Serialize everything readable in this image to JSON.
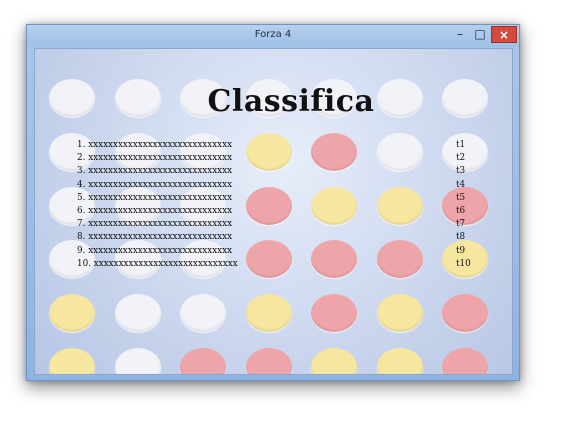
{
  "window": {
    "title": "Forza 4",
    "controls": {
      "minimize": "–",
      "maximize": "□",
      "close": "×"
    }
  },
  "leaderboard": {
    "heading": "Classifica",
    "rows": [
      {
        "name": "1. xxxxxxxxxxxxxxxxxxxxxxxxxxxxx",
        "time": "t1"
      },
      {
        "name": "2. xxxxxxxxxxxxxxxxxxxxxxxxxxxxx",
        "time": "t2"
      },
      {
        "name": "3. xxxxxxxxxxxxxxxxxxxxxxxxxxxxx",
        "time": "t3"
      },
      {
        "name": "4. xxxxxxxxxxxxxxxxxxxxxxxxxxxxx",
        "time": "t4"
      },
      {
        "name": "5. xxxxxxxxxxxxxxxxxxxxxxxxxxxxx",
        "time": "t5"
      },
      {
        "name": "6. xxxxxxxxxxxxxxxxxxxxxxxxxxxxx",
        "time": "t6"
      },
      {
        "name": "7. xxxxxxxxxxxxxxxxxxxxxxxxxxxxx",
        "time": "t7"
      },
      {
        "name": "8. xxxxxxxxxxxxxxxxxxxxxxxxxxxxx",
        "time": "t8"
      },
      {
        "name": "9. xxxxxxxxxxxxxxxxxxxxxxxxxxxxx",
        "time": "t9"
      },
      {
        "name": "10. xxxxxxxxxxxxxxxxxxxxxxxxxxxxx",
        "time": "t10"
      }
    ]
  },
  "board": {
    "rows": [
      [
        "empty",
        "empty",
        "empty",
        "empty",
        "empty",
        "empty",
        "empty"
      ],
      [
        "empty",
        "empty",
        "empty",
        "yellow",
        "red",
        "empty",
        "empty"
      ],
      [
        "empty",
        "empty",
        "empty",
        "red",
        "yellow",
        "yellow",
        "red"
      ],
      [
        "empty",
        "empty",
        "empty",
        "red",
        "red",
        "red",
        "yellow"
      ],
      [
        "yellow",
        "empty",
        "empty",
        "yellow",
        "red",
        "yellow",
        "red"
      ],
      [
        "yellow",
        "empty",
        "red",
        "red",
        "yellow",
        "yellow",
        "red"
      ]
    ]
  },
  "colors": {
    "empty_disc": "#f1f3f8",
    "yellow_disc": "#f6e6a0",
    "red_disc": "#eea5a9",
    "close_button": "#d24b3f"
  }
}
